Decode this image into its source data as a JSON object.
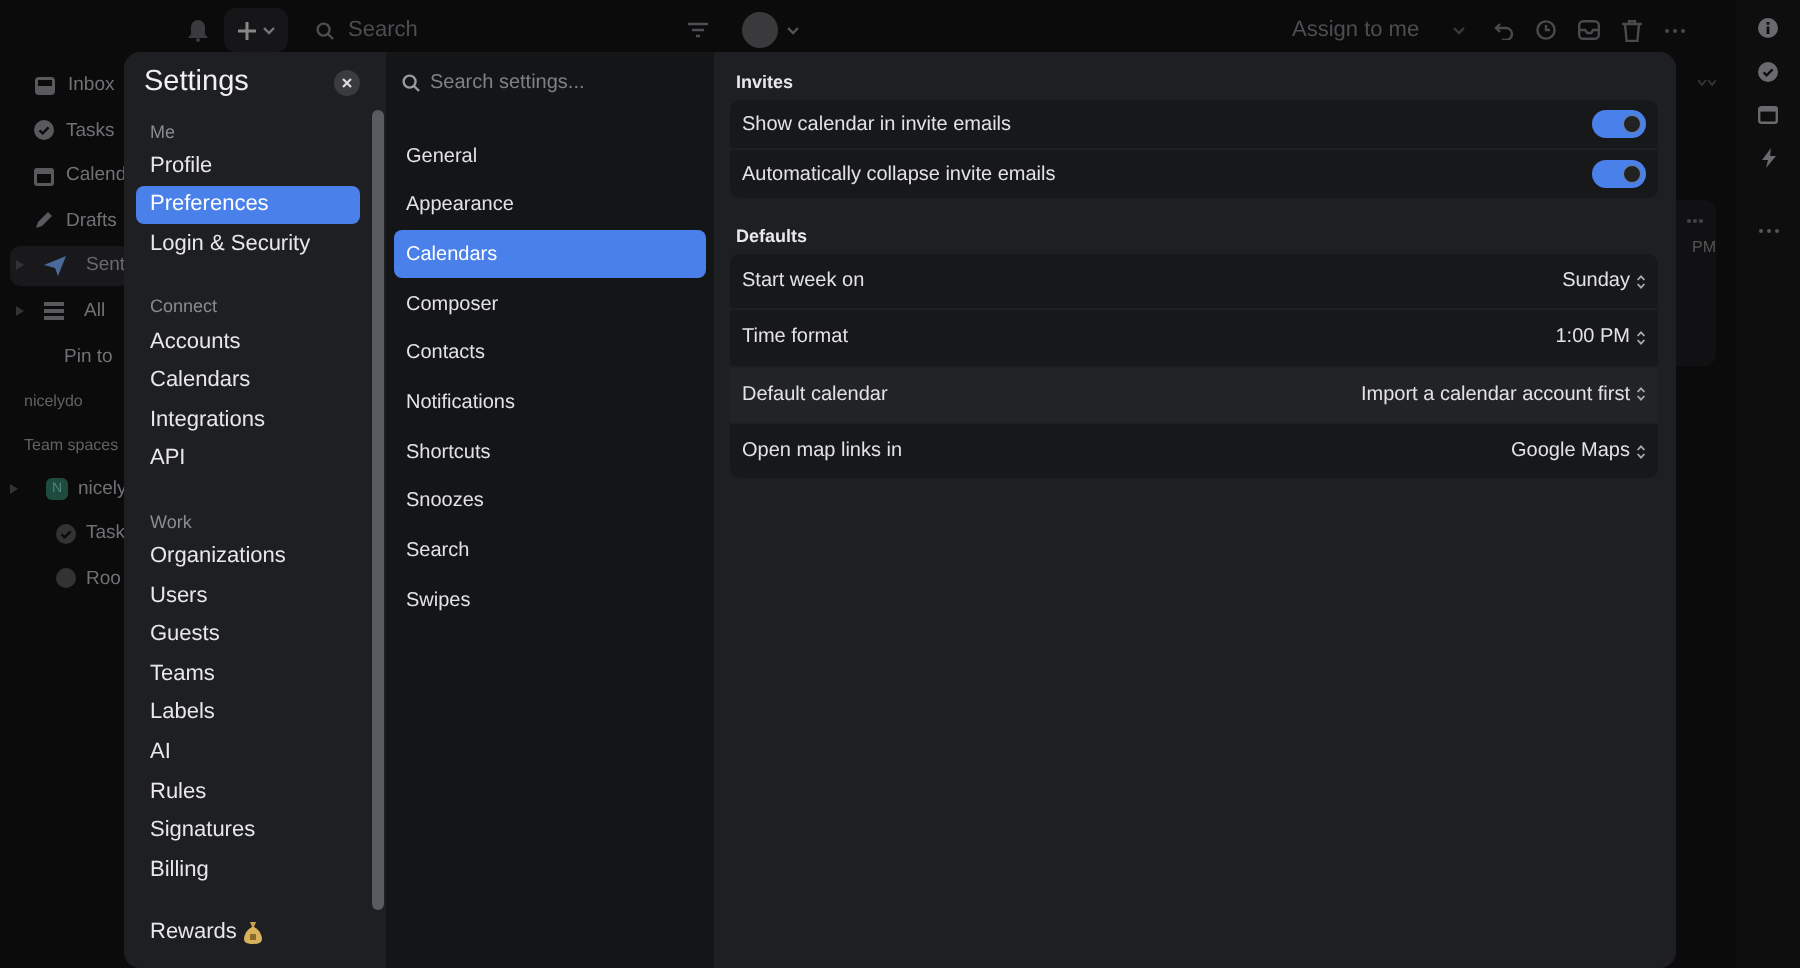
{
  "top_bar": {
    "search": {
      "placeholder": "Search"
    },
    "assign_button": "Assign to me"
  },
  "sidebar": {
    "items": [
      {
        "label": "Inbox",
        "selected": false
      },
      {
        "label": "Tasks",
        "selected": false
      },
      {
        "label": "Calend",
        "selected": false
      },
      {
        "label": "Drafts",
        "selected": false
      },
      {
        "label": "Sent",
        "selected": true
      },
      {
        "label": "All",
        "selected": false
      }
    ],
    "pin_label": "Pin to",
    "account": "nicelydo",
    "team_spaces_label": "Team spaces",
    "team": {
      "label": "nicely",
      "badge": "N",
      "children": [
        {
          "label": "Task"
        },
        {
          "label": "Roo"
        }
      ]
    }
  },
  "background_card": {
    "time": "PM"
  },
  "settings": {
    "title": "Settings",
    "nav_sections": [
      {
        "heading": "Me",
        "items": [
          {
            "label": "Profile",
            "selected": false
          },
          {
            "label": "Preferences",
            "selected": true
          },
          {
            "label": "Login & Security",
            "selected": false
          }
        ]
      },
      {
        "heading": "Connect",
        "items": [
          {
            "label": "Accounts",
            "selected": false
          },
          {
            "label": "Calendars",
            "selected": false
          },
          {
            "label": "Integrations",
            "selected": false
          },
          {
            "label": "API",
            "selected": false
          }
        ]
      },
      {
        "heading": "Work",
        "items": [
          {
            "label": "Organizations",
            "selected": false
          },
          {
            "label": "Users",
            "selected": false
          },
          {
            "label": "Guests",
            "selected": false
          },
          {
            "label": "Teams",
            "selected": false
          },
          {
            "label": "Labels",
            "selected": false
          },
          {
            "label": "AI",
            "selected": false
          },
          {
            "label": "Rules",
            "selected": false
          },
          {
            "label": "Signatures",
            "selected": false
          },
          {
            "label": "Billing",
            "selected": false
          }
        ]
      },
      {
        "items": [
          {
            "label": "Rewards",
            "selected": false
          }
        ]
      }
    ],
    "subnav": {
      "search": {
        "placeholder": "Search settings..."
      },
      "items": [
        {
          "label": "General",
          "selected": false
        },
        {
          "label": "Appearance",
          "selected": false
        },
        {
          "label": "Calendars",
          "selected": true
        },
        {
          "label": "Composer",
          "selected": false
        },
        {
          "label": "Contacts",
          "selected": false
        },
        {
          "label": "Notifications",
          "selected": false
        },
        {
          "label": "Shortcuts",
          "selected": false
        },
        {
          "label": "Snoozes",
          "selected": false
        },
        {
          "label": "Search",
          "selected": false
        },
        {
          "label": "Swipes",
          "selected": false
        }
      ]
    },
    "groups": [
      {
        "title": "Invites",
        "rows": [
          {
            "kind": "toggle",
            "label": "Show calendar in invite emails",
            "on": true
          },
          {
            "kind": "toggle",
            "label": "Automatically collapse invite emails",
            "on": true
          }
        ]
      },
      {
        "title": "Defaults",
        "rows": [
          {
            "kind": "select",
            "label": "Start week on",
            "value": "Sunday",
            "hovered": false
          },
          {
            "kind": "select",
            "label": "Time format",
            "value": "1:00 PM",
            "hovered": false
          },
          {
            "kind": "select",
            "label": "Default calendar",
            "value": "Import a calendar account first",
            "hovered": true
          },
          {
            "kind": "select",
            "label": "Open map links in",
            "value": "Google Maps",
            "hovered": false
          }
        ]
      }
    ]
  }
}
